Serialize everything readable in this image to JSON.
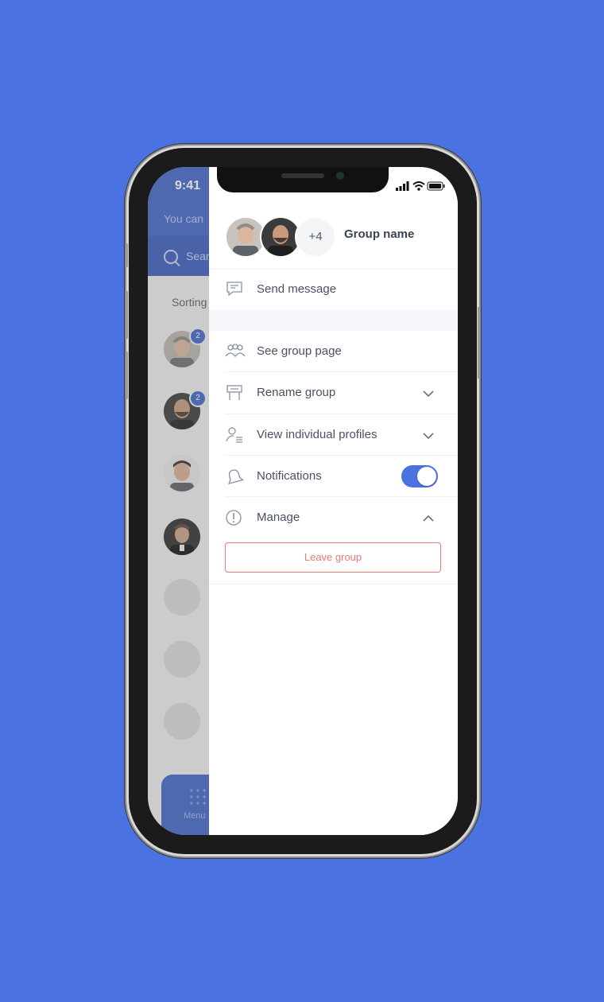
{
  "colors": {
    "background": "#4a72e1",
    "accent": "#4a72e1",
    "danger": "#f0777b",
    "text": "#4a5163"
  },
  "status_bar": {
    "time": "9:41",
    "icons": [
      "signal-icon",
      "wifi-icon",
      "battery-icon"
    ]
  },
  "background_app": {
    "hint_text": "You can",
    "search_placeholder": "Sear",
    "sorting_label": "Sorting",
    "badges": [
      "2",
      "2"
    ],
    "menu_label": "Menu"
  },
  "drawer": {
    "group": {
      "extra_members": "+4",
      "name": "Group name"
    },
    "send_message": "Send message",
    "items": [
      {
        "label": "See group page",
        "icon": "group-icon"
      },
      {
        "label": "Rename group",
        "icon": "rename-icon",
        "control": "chevron-down"
      },
      {
        "label": "View individual profiles",
        "icon": "profile-list-icon",
        "control": "chevron-down"
      },
      {
        "label": "Notifications",
        "icon": "bell-icon",
        "control": "toggle",
        "enabled": true
      },
      {
        "label": "Manage",
        "icon": "info-icon",
        "control": "chevron-up"
      }
    ],
    "leave_button": "Leave group"
  }
}
